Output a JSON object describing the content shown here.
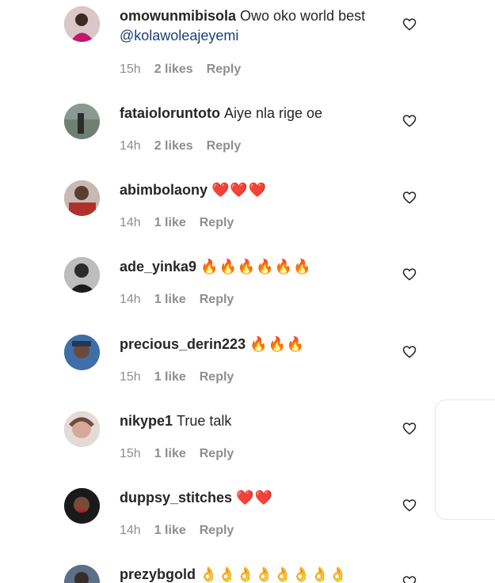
{
  "comments": [
    {
      "username": "omowunmibisola",
      "text": "Owo oko world best",
      "mention": "@kolawoleajeyemi",
      "time": "15h",
      "likes": "2 likes",
      "reply": "Reply",
      "emoji": ""
    },
    {
      "username": "fataioloruntoto",
      "text": "Aiye nla rige oe",
      "mention": "",
      "time": "14h",
      "likes": "2 likes",
      "reply": "Reply",
      "emoji": ""
    },
    {
      "username": "abimbolaony",
      "text": "",
      "mention": "",
      "time": "14h",
      "likes": "1 like",
      "reply": "Reply",
      "emoji": "❤️❤️❤️"
    },
    {
      "username": "ade_yinka9",
      "text": "",
      "mention": "",
      "time": "14h",
      "likes": "1 like",
      "reply": "Reply",
      "emoji": "🔥🔥🔥🔥🔥🔥"
    },
    {
      "username": "precious_derin223",
      "text": "",
      "mention": "",
      "time": "15h",
      "likes": "1 like",
      "reply": "Reply",
      "emoji": "🔥🔥🔥"
    },
    {
      "username": "nikype1",
      "text": "True talk",
      "mention": "",
      "time": "15h",
      "likes": "1 like",
      "reply": "Reply",
      "emoji": ""
    },
    {
      "username": "duppsy_stitches",
      "text": "",
      "mention": "",
      "time": "14h",
      "likes": "1 like",
      "reply": "Reply",
      "emoji": "❤️❤️"
    },
    {
      "username": "prezybgold",
      "text": "",
      "mention": "",
      "time": "",
      "likes": "",
      "reply": "",
      "emoji": "👌👌👌👌👌👌👌👌"
    }
  ],
  "icons": {
    "like": "heart-outline-icon"
  },
  "colors": {
    "text": "#262626",
    "meta": "#8e8e8e",
    "mention": "#1c3f77"
  }
}
